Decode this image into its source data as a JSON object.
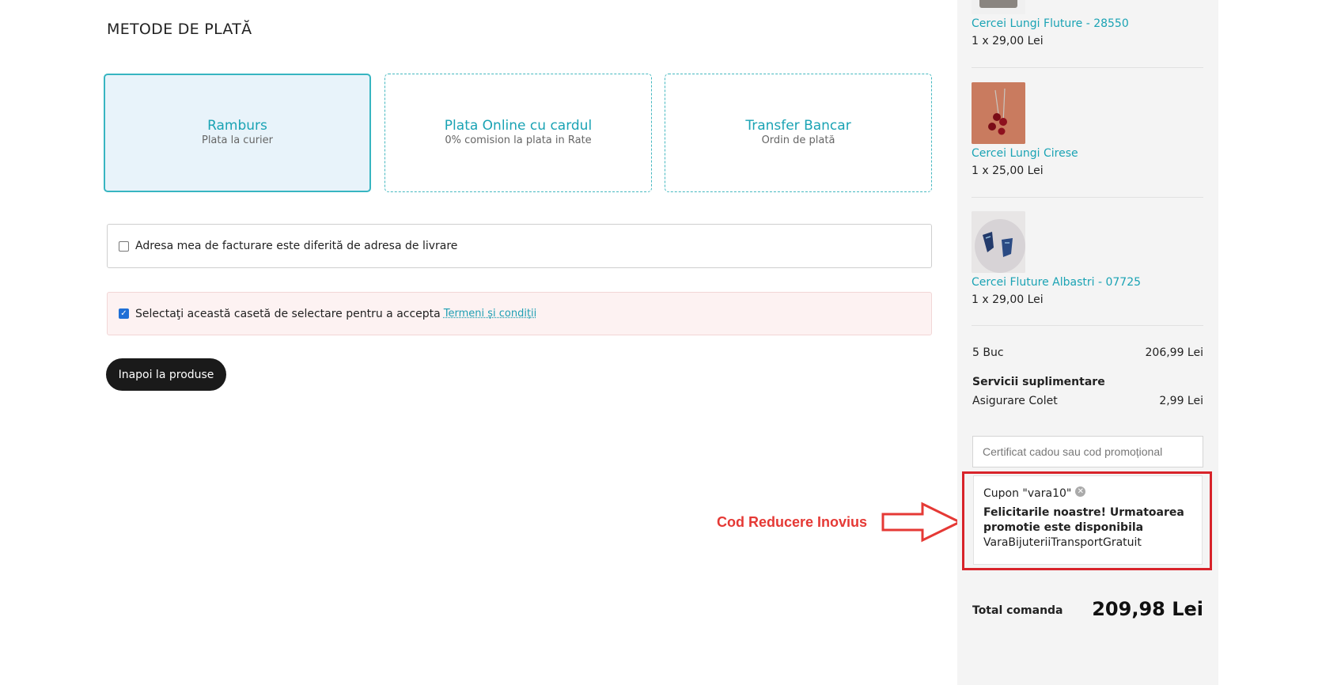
{
  "payment": {
    "section_title": "METODE DE PLATĂ",
    "methods": [
      {
        "title": "Ramburs",
        "subtitle": "Plata la curier",
        "selected": true
      },
      {
        "title": "Plata Online cu cardul",
        "subtitle": "0% comision la plata in Rate",
        "selected": false
      },
      {
        "title": "Transfer Bancar",
        "subtitle": "Ordin de plată",
        "selected": false
      }
    ]
  },
  "billing": {
    "label": "Adresa mea de facturare este diferită de adresa de livrare",
    "checked": false
  },
  "terms": {
    "label": "Selectaţi această casetă de selectare pentru a accepta",
    "link": "Termeni și condiții",
    "checked": true
  },
  "back_button": "Inapoi la produse",
  "annotation": {
    "text": "Cod Reducere Inovius",
    "color": "#e53935"
  },
  "cart": {
    "items": [
      {
        "name": "Cercei Lungi Fluture - 28550",
        "qty": "1 x 29,00 Lei"
      },
      {
        "name": "Cercei Lungi Cirese",
        "qty": "1 x 25,00 Lei"
      },
      {
        "name": "Cercei Fluture Albastri - 07725",
        "qty": "1 x 29,00 Lei"
      }
    ],
    "count_label": "5 Buc",
    "subtotal": "206,99 Lei",
    "extras_title": "Servicii suplimentare",
    "insurance_label": "Asigurare Colet",
    "insurance_price": "2,99 Lei",
    "promo_placeholder": "Certificat cadou sau cod promoțional",
    "coupon": {
      "label": "Cupon \"vara10\"",
      "message": "Felicitarile noastre! Urmatoarea promotie este disponibila",
      "promo_name": "VaraBijuteriiTransportGratuit"
    },
    "total_label": "Total comanda",
    "total_value": "209,98 Lei"
  },
  "colors": {
    "accent": "#1aa3b4",
    "selected_bg": "#e8f3fa",
    "highlight": "#d8232a"
  }
}
